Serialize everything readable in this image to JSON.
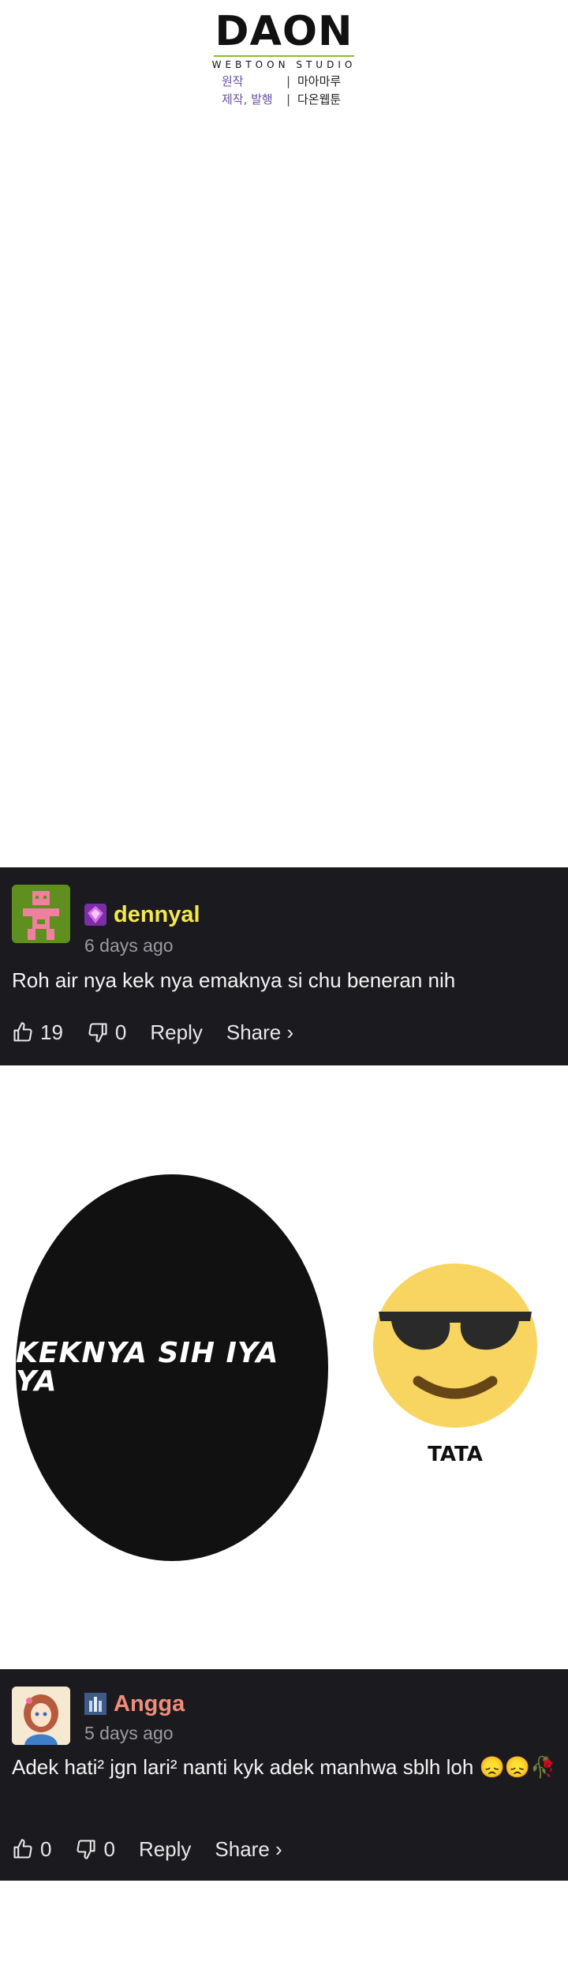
{
  "header": {
    "logo": "DAON",
    "logo_sub": "WEBTOON STUDIO",
    "credits": [
      {
        "key": "원작",
        "value": "마아마루"
      },
      {
        "key": "제작, 발행",
        "value": "다온웹툰"
      }
    ]
  },
  "comments": [
    {
      "username": "dennyal",
      "username_color": "#f5e84b",
      "time": "6 days ago",
      "text": "Roh air nya kek nya emaknya si chu beneran nih",
      "likes": "19",
      "dislikes": "0",
      "reply_label": "Reply",
      "share_label": "Share ›",
      "avatar_icon": "pixel-character-avatar",
      "badge_icon": "purple-gem-badge"
    },
    {
      "username": "Angga",
      "username_color": "#ef8c7c",
      "time": "5 days ago",
      "text": "Adek hati² jgn lari² nanti kyk adek manhwa sblh loh 😞😞🥀",
      "likes": "0",
      "dislikes": "0",
      "reply_label": "Reply",
      "share_label": "Share ›",
      "avatar_icon": "anime-girl-avatar",
      "badge_icon": "blue-castle-badge"
    }
  ],
  "panel": {
    "bubble_text": "KEKNYA SIH IYA YA",
    "caption": "TATA",
    "emoji_icon": "sunglasses-emoji"
  }
}
